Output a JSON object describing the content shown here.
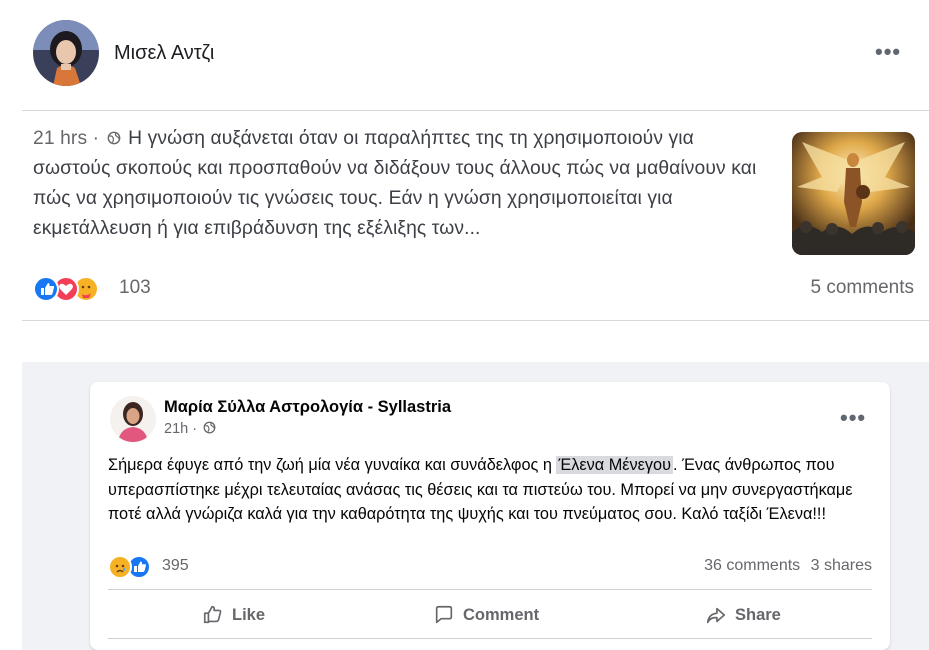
{
  "post1": {
    "author": "Μισελ Αντζι",
    "more_label": "•••",
    "time": "21 hrs",
    "separator": "·",
    "text": "Η γνώση αυξάνεται όταν οι παραλήπτες της τη χρησιμοποιούν για σωστούς σκοπούς και προσπαθούν να διδάξουν τους άλλους πώς να μαθαίνουν και πώς να χρησιμοποιούν τις γνώσεις τους. Εάν η γνώση χρησιμοποιείται για εκμετάλλευση ή για επιβράδυνση της εξέλιξης των...",
    "reactions": [
      "like",
      "love",
      "care"
    ],
    "reaction_count": "103",
    "comments": "5 comments"
  },
  "post2": {
    "author": "Μαρία Σύλλα Αστρολογία - Syllastria",
    "time": "21h",
    "separator": "·",
    "more_label": "•••",
    "text_before": "Σήμερα έφυγε από την ζωή μία νέα γυναίκα και συνάδελφος η ",
    "mention": "Έλενα Μένεγου",
    "text_after": ". Ένας άνθρωπος που υπερασπίστηκε μέχρι τελευταίας ανάσας τις θέσεις και τα πιστεύω του. Μπορεί να μην συνεργαστήκαμε ποτέ αλλά γνώριζα καλά για την καθαρότητα της ψυχής και του πνεύματος σου. Καλό ταξίδι Έλενα!!!",
    "reactions": [
      "sad",
      "like"
    ],
    "reaction_count": "395",
    "comments": "36 comments",
    "shares": "3 shares",
    "actions": {
      "like": "Like",
      "comment": "Comment",
      "share": "Share"
    }
  },
  "colors": {
    "like_blue": "#1877f2",
    "love_red": "#f33e58",
    "reaction_yellow": "#f7b125",
    "secondary_text": "#65676b",
    "feed_background": "#f0f2f5"
  }
}
